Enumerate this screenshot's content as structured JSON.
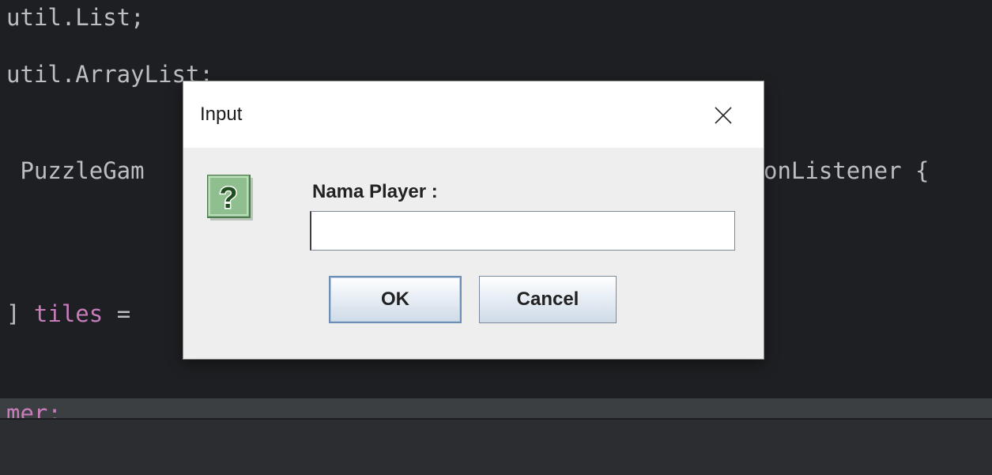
{
  "editor": {
    "line1": "util.List;",
    "line2": "util.ArrayList;",
    "line3_left": " PuzzleGam",
    "line3_right": "onListener {",
    "line4_bracket": "] ",
    "line4_ident": "tiles",
    "line4_rest": " =",
    "line5": "mer;"
  },
  "dialog": {
    "title": "Input",
    "close_icon": "close-icon",
    "question_icon": "question-icon",
    "label": "Nama Player :",
    "input_value": "",
    "input_placeholder": "",
    "ok_label": "OK",
    "cancel_label": "Cancel"
  },
  "colors": {
    "editor_bg": "#1e1f22",
    "code_text": "#bcbec4",
    "identifier_purple": "#c77dbb",
    "dialog_bg": "#eeeeee",
    "icon_green": "#8fbf8f"
  }
}
